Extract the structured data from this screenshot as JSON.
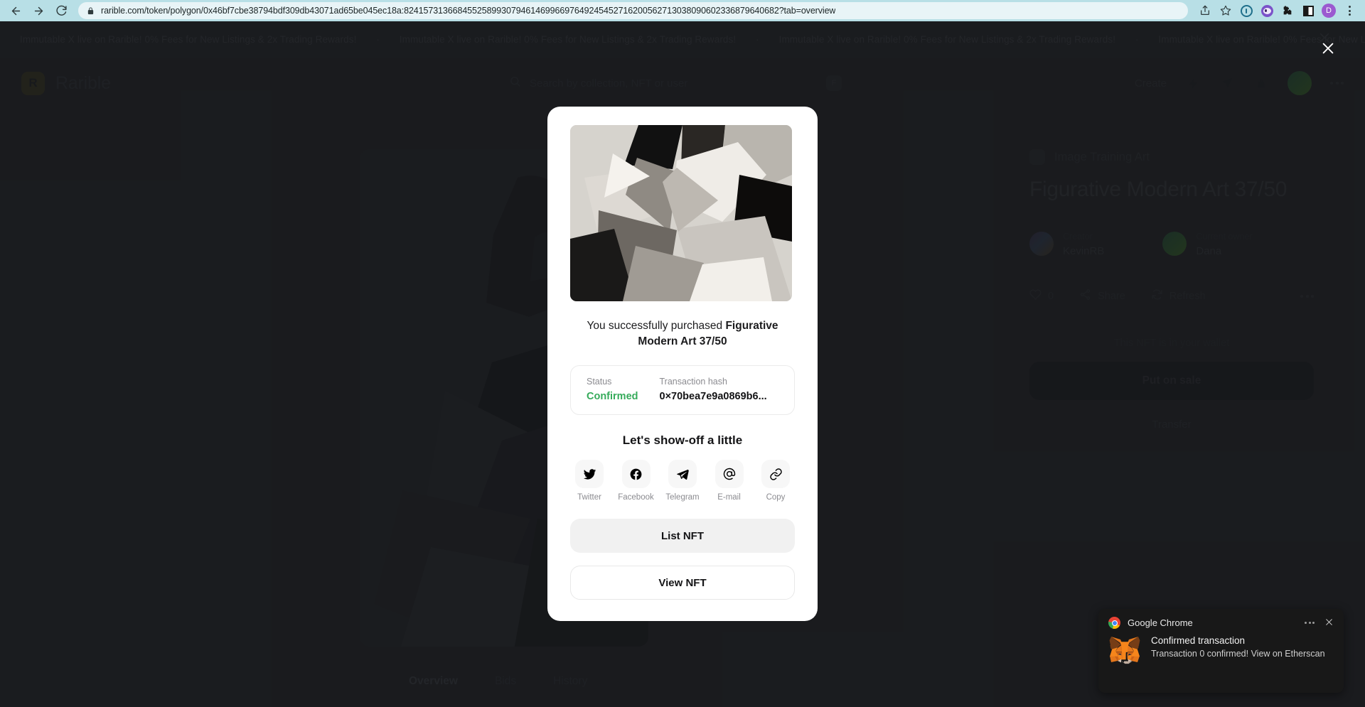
{
  "browser": {
    "url": "rarible.com/token/polygon/0x46bf7cbe38794bdf309db43071ad65be045ec18a:82415731366845525899307946146996697649245452716200562713038090602336879640682?tab=overview",
    "back_icon": "back-arrow-icon",
    "forward_icon": "forward-arrow-icon",
    "reload_icon": "reload-icon",
    "lock_icon": "lock-icon",
    "share_icon": "share-icon",
    "bookmark_icon": "star-icon",
    "profile_initial": "D",
    "menu_icon": "kebab-menu-icon"
  },
  "promo": {
    "message": "Immutable X live on Rarible! 0% Fees for New Listings & 2x Trading Rewards!",
    "separator": "·",
    "close_label": "×"
  },
  "header": {
    "logo_mark": "R",
    "logo_text": "Rarible",
    "search_placeholder": "Search by collection, NFT or user",
    "search_shortcut": "F",
    "create_label": "Create",
    "icons": [
      "lightning-icon",
      "paper-plane-icon",
      "bag-icon"
    ],
    "more_label": "···"
  },
  "nft": {
    "collection": "Image Training Art",
    "title": "Figurative Modern Art 37/50",
    "creator_label": "Creator",
    "creator": "KevinRB",
    "owner_label": "Current owner",
    "owner": "Dana",
    "likes": "0",
    "share_label": "Share",
    "refresh_label": "Refresh",
    "wallet_note": "This NFT is in your wallet",
    "put_on_sale_label": "Put on sale",
    "transfer_label": "Transfer",
    "tabs": [
      {
        "label": "Overview",
        "active": true
      },
      {
        "label": "Bids",
        "active": false
      },
      {
        "label": "History",
        "active": false
      }
    ]
  },
  "modal": {
    "caption_prefix": "You successfully purchased ",
    "caption_item": "Figurative Modern Art 37/50",
    "status_label": "Status",
    "status_value": "Confirmed",
    "status_color": "#36ab5b",
    "tx_label": "Transaction hash",
    "tx_value": "0×70bea7e9a0869b6...",
    "share_title": "Let's show-off a little",
    "share_items": [
      {
        "label": "Twitter",
        "icon": "twitter-icon"
      },
      {
        "label": "Facebook",
        "icon": "facebook-icon"
      },
      {
        "label": "Telegram",
        "icon": "telegram-icon"
      },
      {
        "label": "E-mail",
        "icon": "email-at-icon"
      },
      {
        "label": "Copy",
        "icon": "link-copy-icon"
      }
    ],
    "list_nft_label": "List NFT",
    "view_nft_label": "View NFT",
    "close_label": "×"
  },
  "notification": {
    "app": "Google Chrome",
    "title": "Confirmed transaction",
    "body": "Transaction 0 confirmed! View on Etherscan",
    "more_label": "···",
    "close_label": "×"
  }
}
